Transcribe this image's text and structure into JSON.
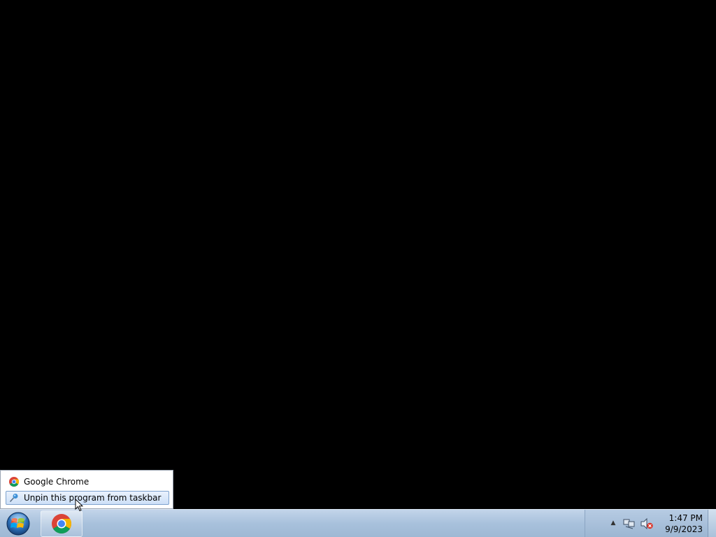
{
  "jump_list": {
    "items": [
      {
        "label": "Google Chrome",
        "icon": "chrome-icon"
      },
      {
        "label": "Unpin this program from taskbar",
        "icon": "unpin-icon"
      }
    ]
  },
  "taskbar": {
    "start_icon": "windows-start-orb-icon",
    "pinned": [
      {
        "icon": "chrome-icon"
      }
    ]
  },
  "tray": {
    "icons": [
      "show-hidden-icons-arrow-icon",
      "network-icon",
      "volume-muted-icon"
    ],
    "time": "1:47 PM",
    "date": "9/9/2023"
  },
  "colors": {
    "desktop": "#000000",
    "taskbar": "#a8c1dc",
    "highlight_border": "#7da2ce"
  }
}
